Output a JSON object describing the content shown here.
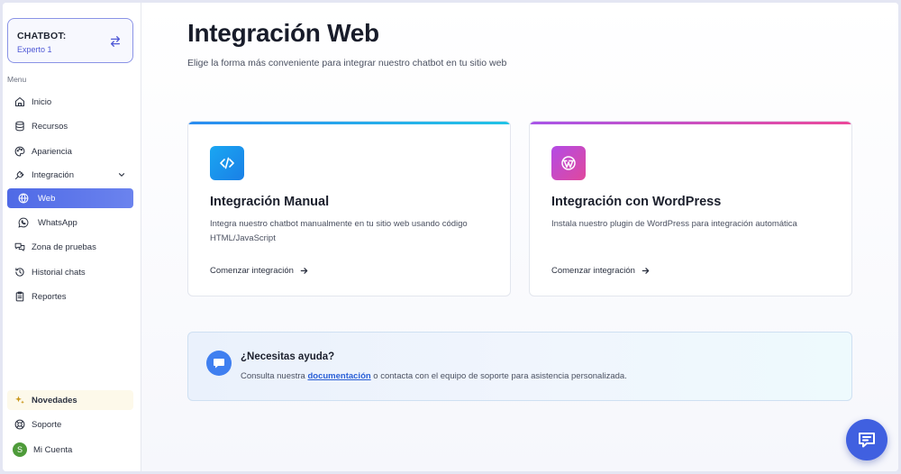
{
  "sidebar": {
    "bot_title": "CHATBOT:",
    "bot_name": "Experto 1",
    "menu_label": "Menu",
    "items": [
      {
        "label": "Inicio",
        "icon": "home-icon"
      },
      {
        "label": "Recursos",
        "icon": "database-icon"
      },
      {
        "label": "Apariencia",
        "icon": "palette-icon"
      },
      {
        "label": "Integración",
        "icon": "plug-icon"
      },
      {
        "label": "Web",
        "icon": "globe-icon"
      },
      {
        "label": "WhatsApp",
        "icon": "whatsapp-icon"
      },
      {
        "label": "Zona de pruebas",
        "icon": "chat-bubbles-icon"
      },
      {
        "label": "Historial chats",
        "icon": "history-icon"
      },
      {
        "label": "Reportes",
        "icon": "clipboard-icon"
      }
    ],
    "bottom": {
      "news": "Novedades",
      "support": "Soporte",
      "account": "Mi Cuenta",
      "avatar_letter": "S"
    }
  },
  "main": {
    "title": "Integración Web",
    "subtitle": "Elige la forma más conveniente para integrar nuestro chatbot en tu sitio web",
    "cards": [
      {
        "title": "Integración Manual",
        "description": "Integra nuestro chatbot manualmente en tu sitio web usando código HTML/JavaScript",
        "link": "Comenzar integración",
        "icon": "code-icon",
        "accent": "#1ea7f0"
      },
      {
        "title": "Integración con WordPress",
        "description": "Instala nuestro plugin de WordPress para integración automática",
        "link": "Comenzar integración",
        "icon": "wordpress-icon",
        "accent": "#c54ee0"
      }
    ],
    "help": {
      "title": "¿Necesitas ayuda?",
      "text_before": "Consulta nuestra ",
      "link": "documentación",
      "text_after": " o contacta con el equipo de soporte para asistencia personalizada."
    }
  },
  "colors": {
    "primary": "#4f6ae6",
    "fab": "#4060e0",
    "link": "#2a5fd6"
  }
}
